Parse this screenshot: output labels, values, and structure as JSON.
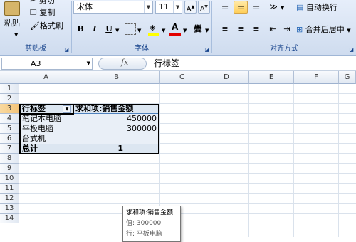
{
  "ribbon": {
    "clipboard": {
      "label": "剪贴板",
      "paste": "粘贴",
      "cut": "剪切",
      "copy": "复制",
      "format_painter": "格式刷"
    },
    "font": {
      "label": "字体",
      "font_name": "宋体",
      "font_size": "11",
      "bold": "B",
      "italic": "I",
      "underline": "U",
      "phonetic": "變"
    },
    "alignment": {
      "label": "对齐方式",
      "wrap_text": "自动换行",
      "merge_center": "合并后居中"
    }
  },
  "formula_bar": {
    "name_box": "A3",
    "fx": "fx",
    "content": "行标签"
  },
  "sheet": {
    "columns": [
      "A",
      "B",
      "C",
      "D",
      "E",
      "F",
      "G"
    ],
    "rows": [
      "1",
      "2",
      "3",
      "4",
      "5",
      "6",
      "7",
      "8",
      "9",
      "10",
      "11",
      "12",
      "13",
      "14"
    ],
    "pivot": {
      "header": {
        "label": "行标签",
        "value": "求和项:销售金额"
      },
      "rows": [
        {
          "label": "笔记本电脑",
          "value": "450000"
        },
        {
          "label": "平板电脑",
          "value": "300000"
        },
        {
          "label": "台式机",
          "value": ""
        }
      ],
      "total": {
        "label": "总计",
        "value": "1"
      }
    }
  },
  "tooltip": {
    "title": "求和项:销售金额",
    "value_line": "值: 300000",
    "row_line": "行: 平板电脑"
  }
}
